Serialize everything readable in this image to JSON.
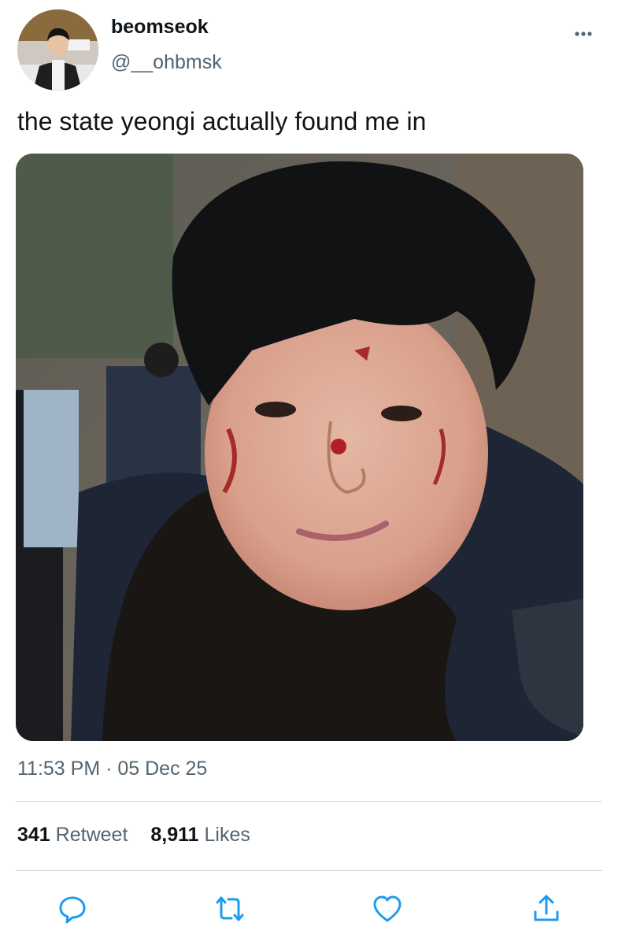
{
  "author": {
    "display_name": "beomseok",
    "handle": "@__ohbmsk",
    "avatar_icon": "profile-photo"
  },
  "tweet": {
    "text": "the state yeongi actually found me in",
    "timestamp": "11:53 PM · 05 Dec 25"
  },
  "stats": {
    "retweets_count": "341",
    "retweets_label": "Retweet",
    "likes_count": "8,911",
    "likes_label": "Likes"
  },
  "actions": [
    {
      "name": "reply",
      "icon": "speech-bubble-icon"
    },
    {
      "name": "retweet",
      "icon": "retweet-arrows-icon"
    },
    {
      "name": "like",
      "icon": "heart-icon"
    },
    {
      "name": "share",
      "icon": "share-upload-icon"
    }
  ],
  "colors": {
    "text_primary": "#0f1419",
    "text_secondary": "#536471",
    "divider": "#cfd9de",
    "icon": "#1d9bf0"
  }
}
